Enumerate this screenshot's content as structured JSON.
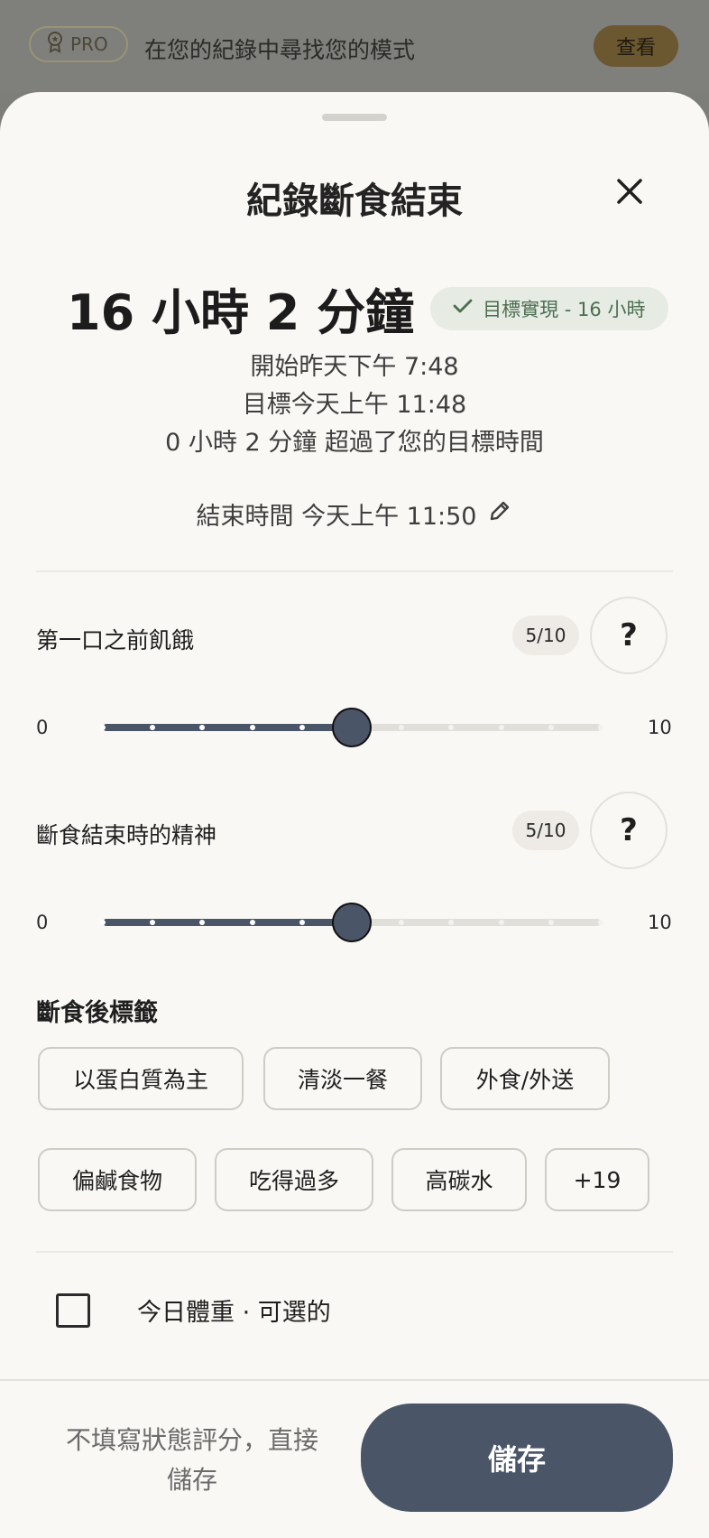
{
  "banner": {
    "pro_label": "PRO",
    "text": "在您的紀錄中尋找您的模式",
    "view_label": "查看"
  },
  "sheet": {
    "title": "紀錄斷食結束",
    "duration": "16 小時 2 分鐘",
    "goal_badge": "目標實現 - 16 小時",
    "start_text": "開始昨天下午 7:48",
    "target_text": "目標今天上午 11:48",
    "exceeded_text": "0 小時 2 分鐘 超過了您的目標時間",
    "end_time_text": "結束時間 今天上午 11:50"
  },
  "hunger": {
    "label": "第一口之前飢餓",
    "score": "5/10",
    "value": 5,
    "min": "0",
    "max": "10",
    "help": "?"
  },
  "energy": {
    "label": "斷食結束時的精神",
    "score": "5/10",
    "value": 5,
    "min": "0",
    "max": "10",
    "help": "?"
  },
  "tags": {
    "title": "斷食後標籤",
    "items": [
      "以蛋白質為主",
      "清淡一餐",
      "外食/外送",
      "偏鹹食物",
      "吃得過多",
      "高碳水",
      "+19"
    ]
  },
  "weight": {
    "label": "今日體重 · 可選的"
  },
  "footer": {
    "skip_label": "不填寫狀態評分，直接儲存",
    "save_label": "儲存"
  },
  "colors": {
    "accent": "#4a5568",
    "goal_green": "#4b6e50",
    "sheet_bg": "#faf8f4"
  }
}
